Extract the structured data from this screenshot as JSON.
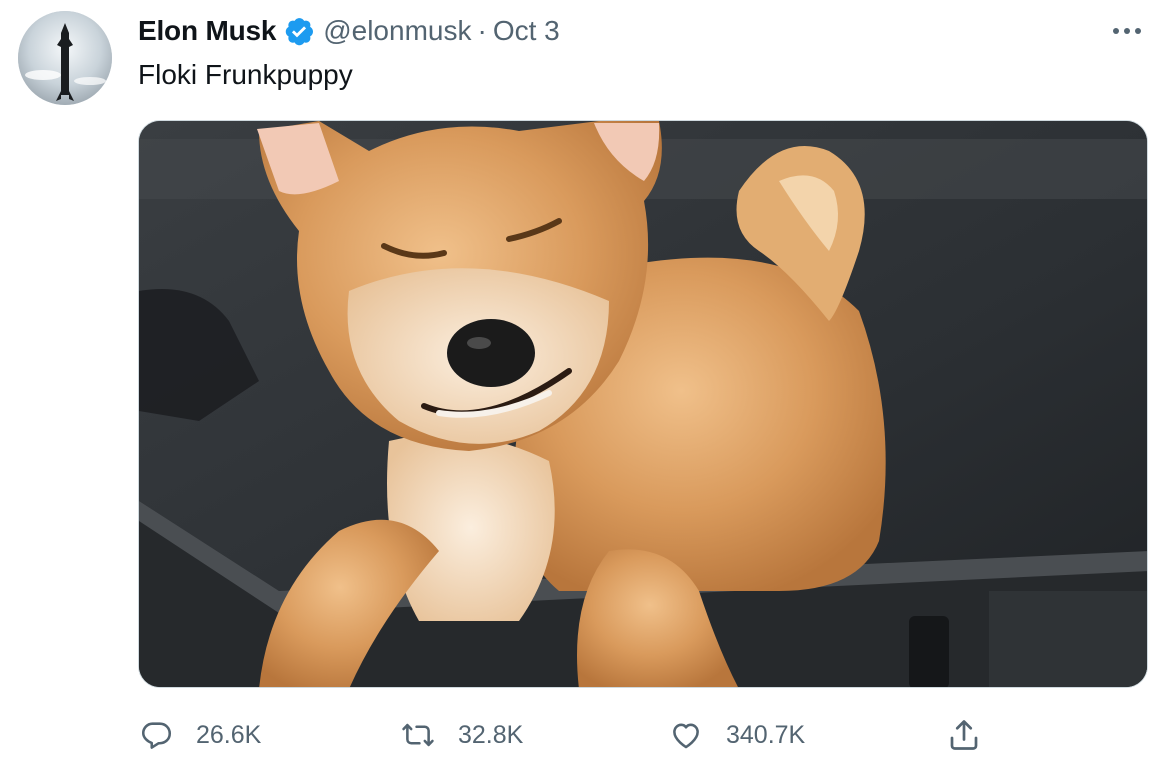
{
  "tweet": {
    "author": {
      "name": "Elon Musk",
      "handle": "@elonmusk",
      "verified": true
    },
    "separator": "·",
    "date": "Oct 3",
    "text": "Floki Frunkpuppy",
    "media": {
      "kind": "photo",
      "subject": "shiba-inu-puppy"
    },
    "stats": {
      "replies": "26.6K",
      "retweets": "32.8K",
      "likes": "340.7K"
    }
  },
  "icons": {
    "more": "more-icon",
    "reply": "reply-icon",
    "retweet": "retweet-icon",
    "like": "heart-icon",
    "share": "share-icon",
    "verified": "verified-badge-icon"
  },
  "colors": {
    "verified_blue": "#1d9bf0",
    "secondary_text": "#536471",
    "primary_text": "#0f1419"
  }
}
